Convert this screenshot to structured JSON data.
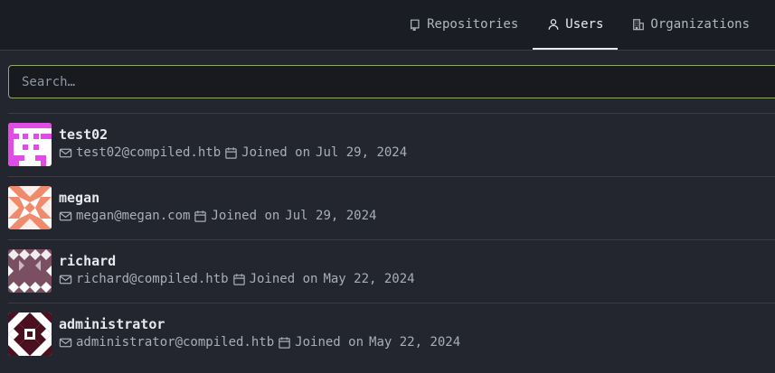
{
  "tabs": [
    {
      "label": "Repositories",
      "icon": "repo-icon"
    },
    {
      "label": "Users",
      "icon": "user-icon",
      "active": true
    },
    {
      "label": "Organizations",
      "icon": "organization-icon"
    }
  ],
  "search": {
    "placeholder": "Search…",
    "value": ""
  },
  "users": [
    {
      "name": "test02",
      "email": "test02@compiled.htb",
      "joined_label": "Joined on",
      "joined_date": "Jul 29, 2024"
    },
    {
      "name": "megan",
      "email": "megan@megan.com",
      "joined_label": "Joined on",
      "joined_date": "Jul 29, 2024"
    },
    {
      "name": "richard",
      "email": "richard@compiled.htb",
      "joined_label": "Joined on",
      "joined_date": "May 22, 2024"
    },
    {
      "name": "administrator",
      "email": "administrator@compiled.htb",
      "joined_label": "Joined on",
      "joined_date": "May 22, 2024"
    }
  ],
  "colors": {
    "accent_border": "#8fa96b",
    "avatar_test02": "#e24ce6",
    "avatar_megan": "#f08a6c",
    "avatar_richard": "#7a4f62",
    "avatar_administrator": "#4a1020"
  }
}
